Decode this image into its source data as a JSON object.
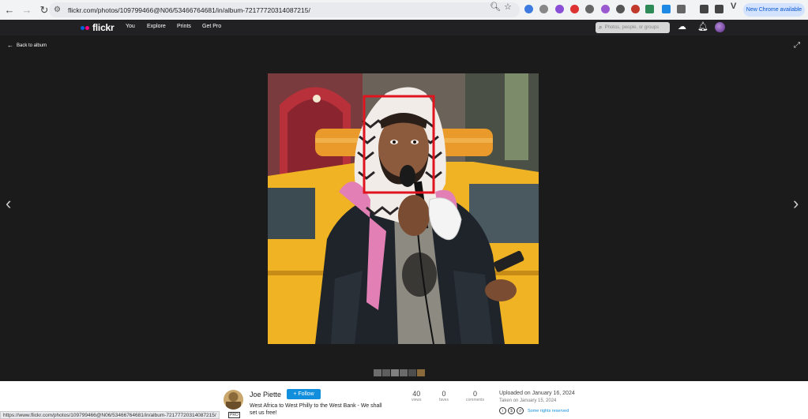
{
  "browser": {
    "url": "flickr.com/photos/109799466@N06/53466764681/in/album-72177720314087215/",
    "new_chrome_label": "New Chrome available",
    "status_url": "https://www.flickr.com/photos/109799466@N06/53466764681/in/album-72177720314087215/"
  },
  "flickr_nav": {
    "logo": "flickr",
    "items": [
      "You",
      "Explore",
      "Prints",
      "Get Pro"
    ],
    "search_placeholder": "Photos, people, or groups"
  },
  "viewer": {
    "back_label": "Back to album",
    "prev_glyph": "‹",
    "next_glyph": "›"
  },
  "info": {
    "owner_name": "Joe Piette",
    "follow_label": "+ Follow",
    "pro_badge": "PRO",
    "description": "West Africa to West Philly to the West Bank - We shall set us free!",
    "stats": [
      {
        "num": "40",
        "label": "views"
      },
      {
        "num": "0",
        "label": "faves"
      },
      {
        "num": "0",
        "label": "comments"
      }
    ],
    "uploaded": "Uploaded on January 16, 2024",
    "taken": "Taken on January 15, 2024",
    "rights": "Some rights reserved"
  },
  "colors": {
    "flickr_blue": "#0063dc",
    "flickr_pink": "#ff0084",
    "follow_blue": "#128fdc",
    "detection_box": "#e0141e"
  }
}
